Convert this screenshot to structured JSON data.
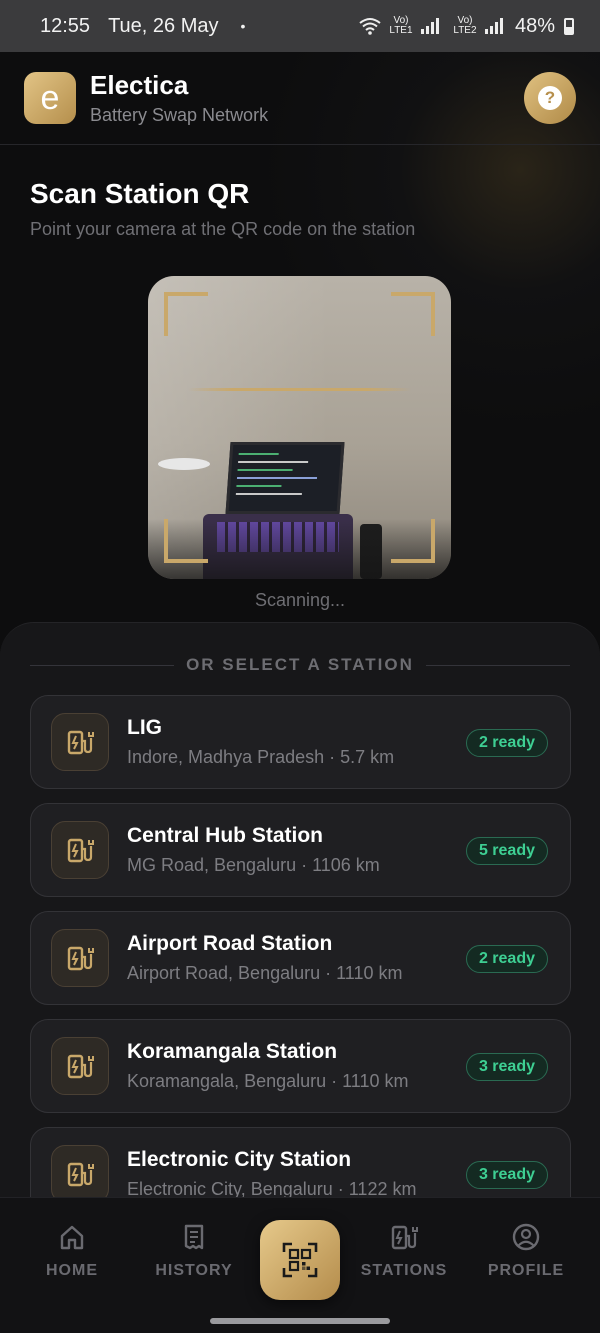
{
  "status_bar": {
    "time": "12:55",
    "date": "Tue, 26 May",
    "dot": "•",
    "sim1": "Vo) LTE1",
    "sim2": "Vo) LTE2",
    "battery": "48%"
  },
  "header": {
    "logo_letter": "e",
    "app_name": "Electica",
    "subtitle": "Battery Swap Network",
    "help_icon": "question-icon",
    "help_symbol": "?"
  },
  "scan": {
    "title": "Scan Station QR",
    "subtitle": "Point your camera at the QR code on the station",
    "status": "Scanning..."
  },
  "sheet": {
    "divider_label": "OR SELECT A STATION",
    "stations": [
      {
        "name": "LIG",
        "meta": "Indore, Madhya Pradesh · 5.7 km",
        "badge": "2 ready"
      },
      {
        "name": "Central Hub Station",
        "meta": "MG Road, Bengaluru · 1106 km",
        "badge": "5 ready"
      },
      {
        "name": "Airport Road Station",
        "meta": "Airport Road, Bengaluru · 1110 km",
        "badge": "2 ready"
      },
      {
        "name": "Koramangala Station",
        "meta": "Koramangala, Bengaluru · 1110 km",
        "badge": "3 ready"
      },
      {
        "name": "Electronic City Station",
        "meta": "Electronic City, Bengaluru · 1122 km",
        "badge": "3 ready"
      }
    ]
  },
  "nav": {
    "home": "HOME",
    "history": "HISTORY",
    "stations": "STATIONS",
    "profile": "PROFILE"
  },
  "colors": {
    "accent_gold": "#c9a86a",
    "ready_green": "#3ecf93",
    "background": "#0d0d0e"
  }
}
